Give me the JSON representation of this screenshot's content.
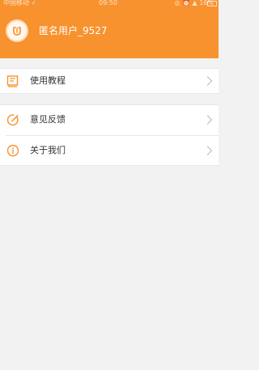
{
  "status_bar": {
    "carrier": "中国移动 ✓",
    "time": "09:50",
    "right": "◎ ⏰ ▲ 16%"
  },
  "header": {
    "avatar_icon": "user-avatar-icon",
    "username": "匿名用户_9527"
  },
  "menu": {
    "tutorial": {
      "label": "使用教程",
      "icon": "book-icon"
    },
    "feedback": {
      "label": "意见反馈",
      "icon": "edit-icon"
    },
    "about": {
      "label": "关于我们",
      "icon": "info-icon"
    }
  },
  "colors": {
    "accent": "#f7922e",
    "background": "#f2f2f2",
    "row_text": "#333333"
  }
}
